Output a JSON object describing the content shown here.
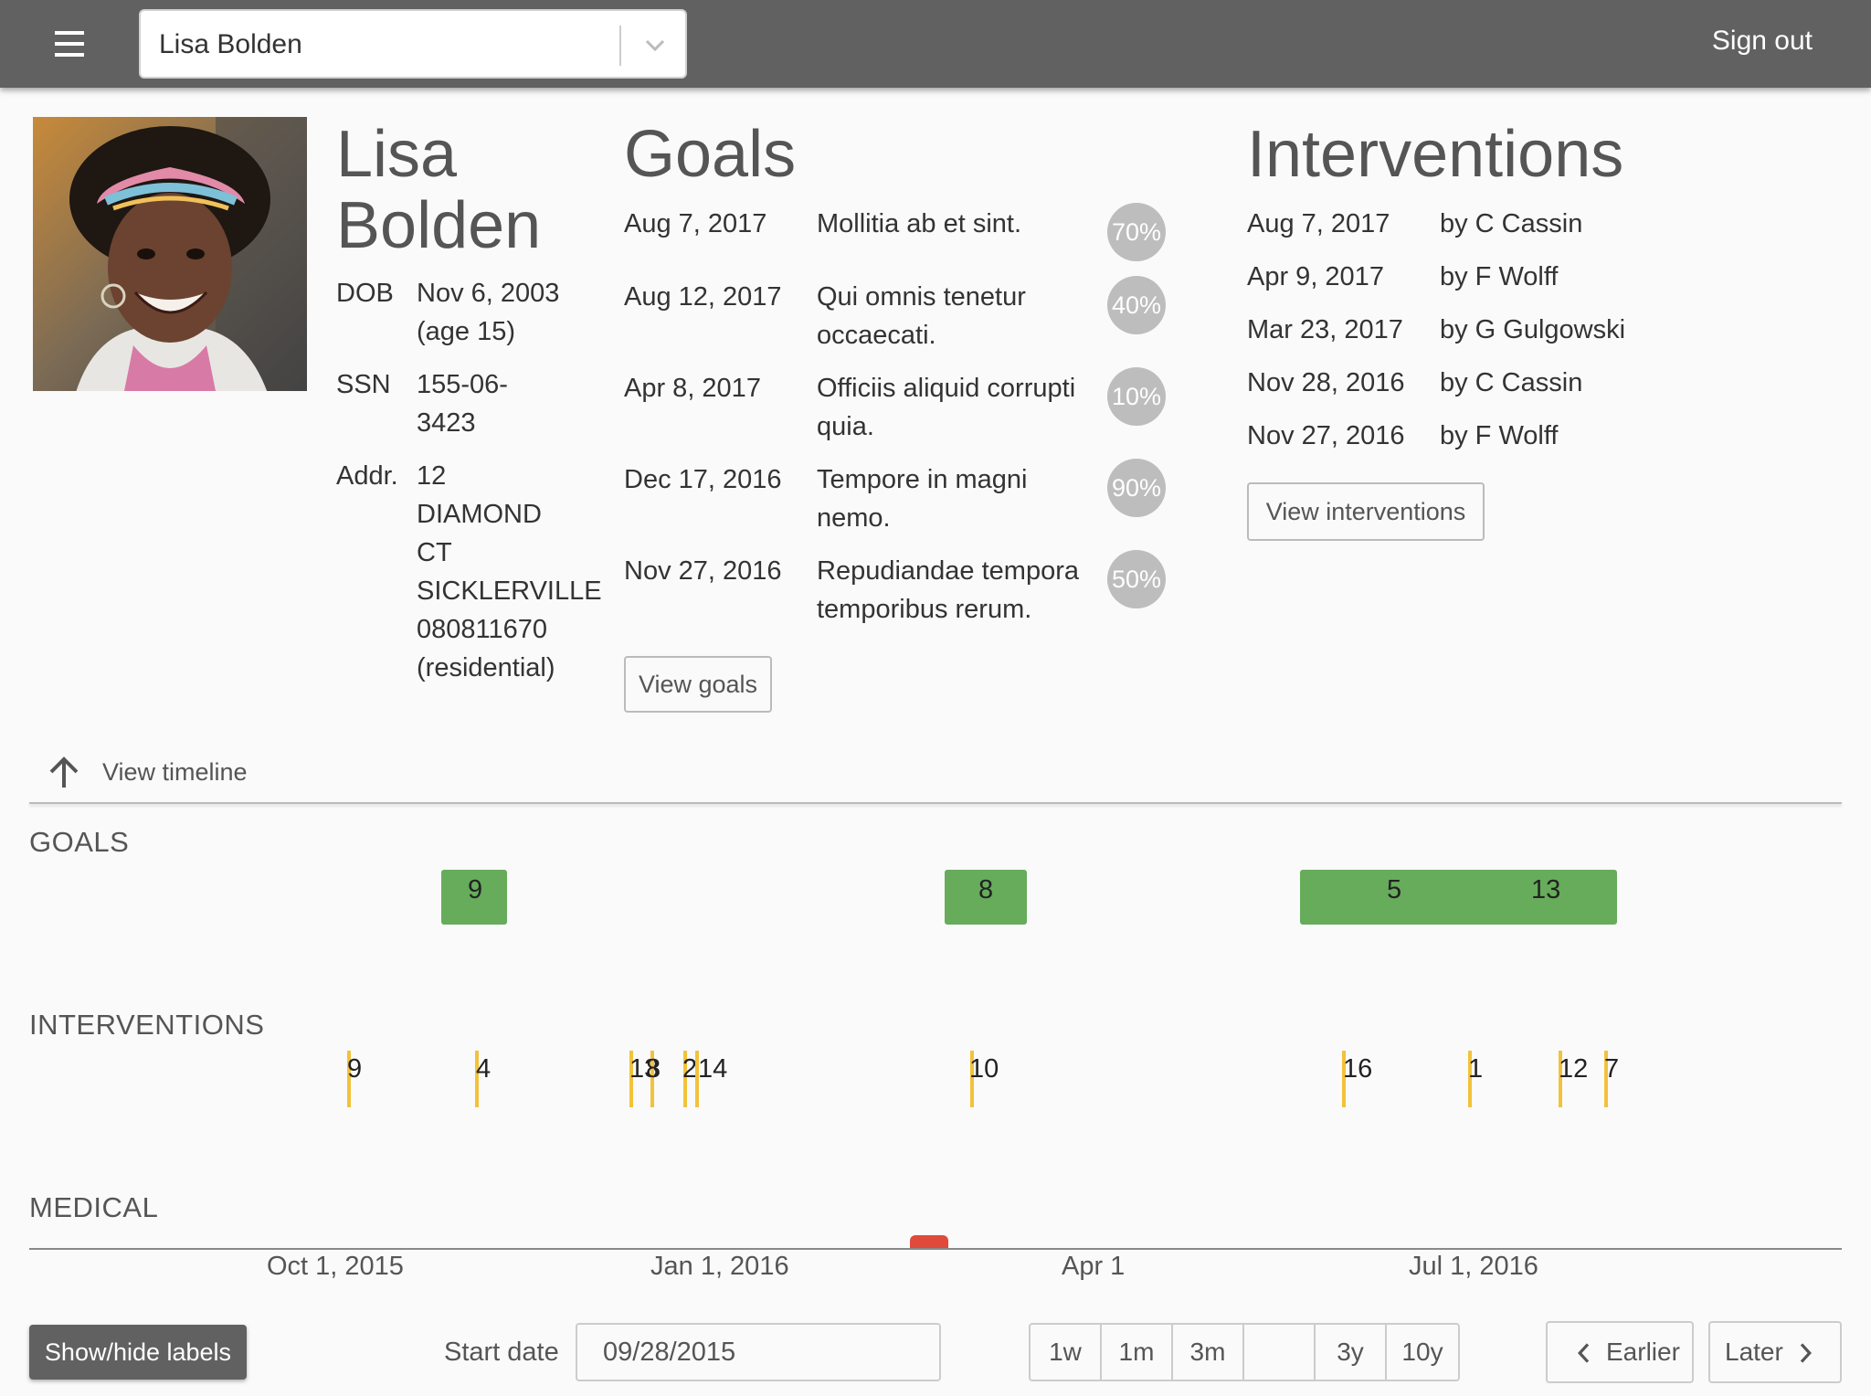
{
  "header": {
    "client_name": "Lisa Bolden",
    "sign_out": "Sign out"
  },
  "profile": {
    "first_name": "Lisa",
    "last_name": "Bolden",
    "dob_label": "DOB",
    "dob_value": "Nov 6, 2003",
    "dob_age": "(age 15)",
    "ssn_label": "SSN",
    "ssn_line1": "155-06-",
    "ssn_line2": "3423",
    "addr_label": "Addr.",
    "addr_lines": [
      "12",
      "DIAMOND",
      "CT",
      "SICKLERVILLE",
      "080811670",
      "(residential)"
    ]
  },
  "goals": {
    "title": "Goals",
    "items": [
      {
        "date": "Aug 7, 2017",
        "text": "Mollitia ab et sint.",
        "pct": "70%"
      },
      {
        "date": "Aug 12, 2017",
        "text": "Qui omnis tenetur occaecati.",
        "pct": "40%"
      },
      {
        "date": "Apr 8, 2017",
        "text": "Officiis aliquid corrupti quia.",
        "pct": "10%"
      },
      {
        "date": "Dec 17, 2016",
        "text": "Tempore in magni nemo.",
        "pct": "90%"
      },
      {
        "date": "Nov 27, 2016",
        "text": "Repudiandae tempora temporibus rerum.",
        "pct": "50%"
      }
    ],
    "view_button": "View goals"
  },
  "interventions": {
    "title": "Interventions",
    "items": [
      {
        "date": "Aug 7, 2017",
        "by": "by C Cassin"
      },
      {
        "date": "Apr 9, 2017",
        "by": "by F Wolff"
      },
      {
        "date": "Mar 23, 2017",
        "by": "by G Gulgowski"
      },
      {
        "date": "Nov 28, 2016",
        "by": "by C Cassin"
      },
      {
        "date": "Nov 27, 2016",
        "by": "by F Wolff"
      }
    ],
    "view_button": "View interventions"
  },
  "timeline": {
    "toggle_label": "View timeline",
    "goals_label": "GOALS",
    "interventions_label": "INTERVENTIONS",
    "medical_label": "MEDICAL",
    "goal_bar_labels": [
      "9",
      "8",
      "5",
      "13"
    ],
    "intervention_labels": [
      "9",
      "4",
      "13",
      "8",
      "2",
      "14",
      "10",
      "16",
      "1",
      "12",
      "7"
    ],
    "axis_labels": [
      "Oct 1, 2015",
      "Jan 1, 2016",
      "Apr 1",
      "Jul 1, 2016"
    ],
    "colors": {
      "goal": "#66ac5b",
      "intervention": "#f2c23b",
      "medical": "#e04a3a"
    }
  },
  "controls": {
    "show_hide": "Show/hide labels",
    "start_date_label": "Start date",
    "start_date_value": "09/28/2015",
    "ranges": [
      "1w",
      "1m",
      "3m",
      "",
      "3y",
      "10y"
    ],
    "earlier": "Earlier",
    "later": "Later"
  }
}
